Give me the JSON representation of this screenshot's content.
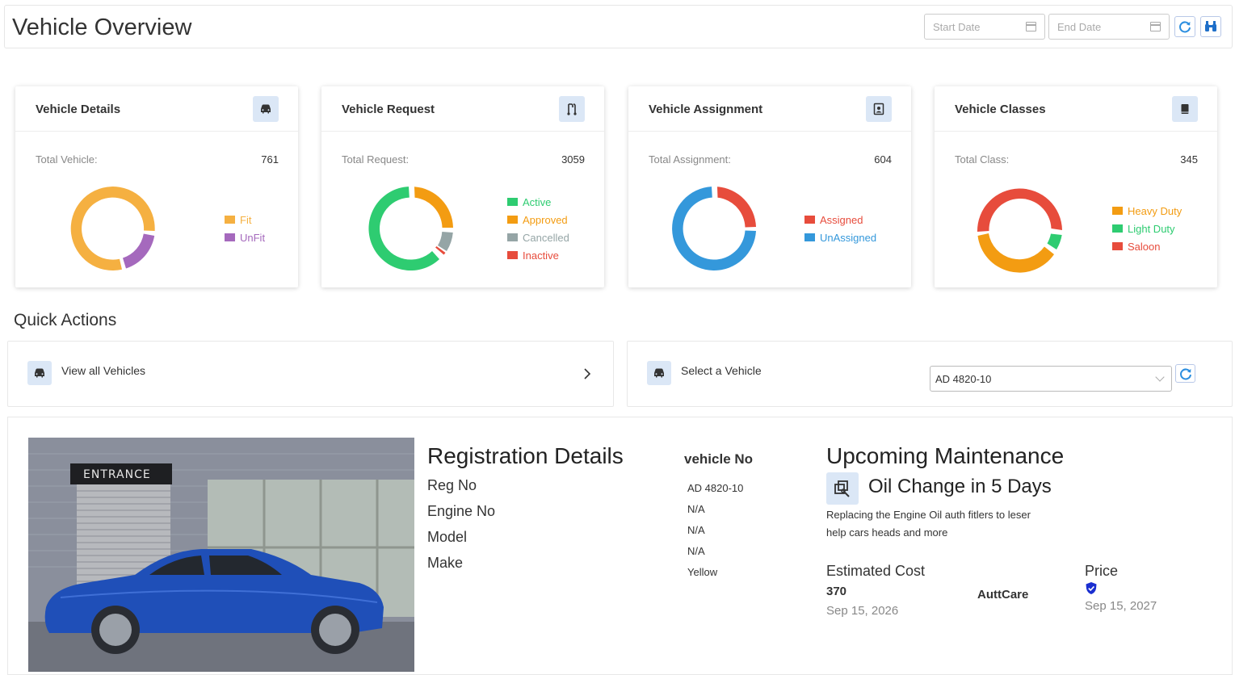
{
  "header": {
    "title": "Vehicle Overview",
    "start_date_placeholder": "Start Date",
    "end_date_placeholder": "End Date"
  },
  "cards": [
    {
      "title": "Vehicle Details",
      "icon": "car-icon",
      "total_label": "Total Vehicle:",
      "total_value": "761",
      "legend": [
        {
          "label": "Fit",
          "color": "#f5b041"
        },
        {
          "label": "UnFit",
          "color": "#a569bd"
        }
      ]
    },
    {
      "title": "Vehicle Request",
      "icon": "request-icon",
      "total_label": "Total Request:",
      "total_value": "3059",
      "legend": [
        {
          "label": "Active",
          "color": "#2ecc71"
        },
        {
          "label": "Approved",
          "color": "#f39c12"
        },
        {
          "label": "Cancelled",
          "color": "#95a5a6"
        },
        {
          "label": "Inactive",
          "color": "#e74c3c"
        }
      ]
    },
    {
      "title": "Vehicle Assignment",
      "icon": "assignment-icon",
      "total_label": "Total Assignment:",
      "total_value": "604",
      "legend": [
        {
          "label": "Assigned",
          "color": "#e74c3c"
        },
        {
          "label": "UnAssigned",
          "color": "#3498db"
        }
      ]
    },
    {
      "title": "Vehicle Classes",
      "icon": "book-icon",
      "total_label": "Total Class:",
      "total_value": "345",
      "legend": [
        {
          "label": "Heavy Duty",
          "color": "#f39c12"
        },
        {
          "label": "Light Duty",
          "color": "#2ecc71"
        },
        {
          "label": "Saloon",
          "color": "#e74c3c"
        }
      ]
    }
  ],
  "quick_actions": {
    "title": "Quick Actions",
    "view_all_label": "View all Vehicles",
    "select_label": "Select a Vehicle",
    "selected_vehicle": "AD 4820-10"
  },
  "registration": {
    "title": "Registration Details",
    "labels": [
      "Reg No",
      "Engine No",
      "Model",
      "Make"
    ],
    "vehicle_no_title": "vehicle No",
    "values": [
      "AD 4820-10",
      "N/A",
      "N/A",
      "N/A",
      "Yellow"
    ],
    "photo_sign_text": "ENTRANCE"
  },
  "maintenance": {
    "title": "Upcoming Maintenance",
    "subtitle": "Oil Change in 5 Days",
    "description": "Replacing the Engine Oil auth fitlers to leser help cars heads and more",
    "estimated_cost_label": "Estimated Cost",
    "estimated_cost_value": "370",
    "estimated_date": "Sep 15, 2026",
    "provider": "AuttCare",
    "price_label": "Price",
    "price_date": "Sep 15, 2027"
  }
}
